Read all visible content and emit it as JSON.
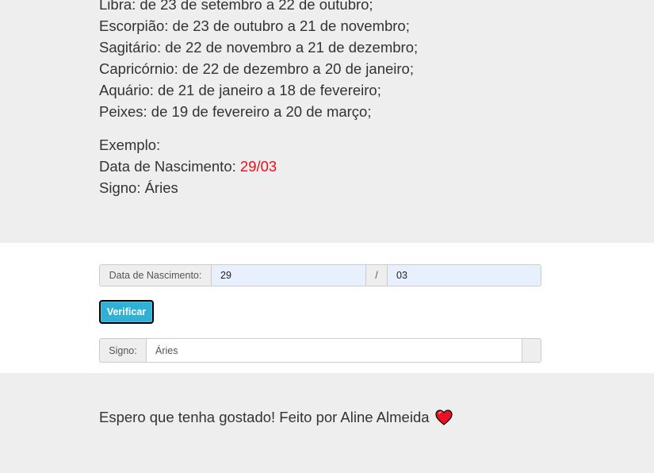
{
  "signs": [
    "Libra: de 23 de setembro a 22 de outubro;",
    "Escorpião: de 23 de outubro a 21 de novembro;",
    "Sagitário: de 22 de novembro a 21 de dezembro;",
    "Capricórnio: de 22 de dezembro a 20 de janeiro;",
    "Aquário: de 21 de janeiro a 18 de fevereiro;",
    "Peixes: de 19 de fevereiro a 20 de março;"
  ],
  "example": {
    "heading": "Exemplo:",
    "birth_label": "Data de Nascimento: ",
    "birth_value": "29/03",
    "sign_line": "Signo: Áries"
  },
  "form": {
    "birth_label": "Data de Nascimento:",
    "day_value": "29",
    "separator": "/",
    "month_value": "03",
    "verify_label": "Verificar",
    "sign_label": "Signo:",
    "sign_value": "Áries"
  },
  "footer": {
    "text": "Espero que tenha gostado! Feito por Aline Almeida",
    "icon": "heart-icon",
    "icon_color": "#e81224"
  },
  "colors": {
    "highlight": "#e8111b",
    "button": "#31b0d5",
    "autofill": "#e8f0fe"
  }
}
